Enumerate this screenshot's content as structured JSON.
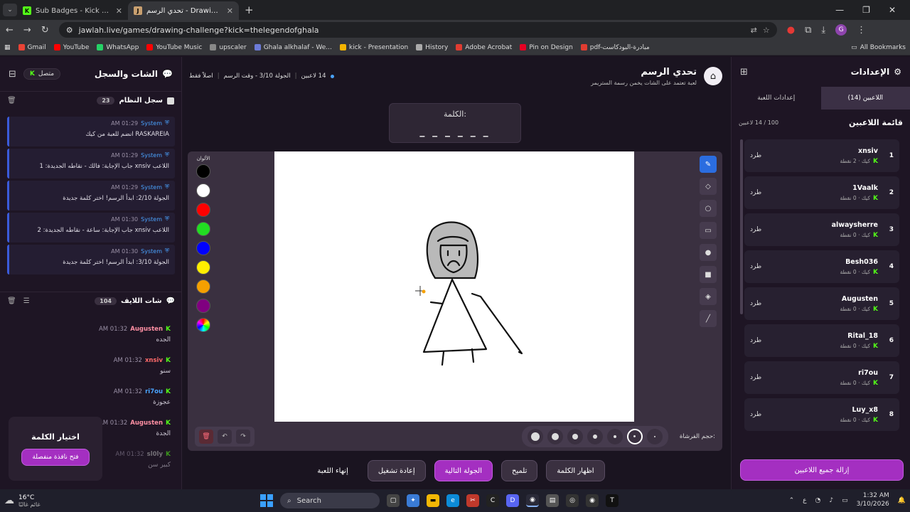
{
  "browser": {
    "tabs": [
      {
        "title": "Sub Badges - Kick Dashboard",
        "fav_color": "#53fc18",
        "fav_glyph": "K"
      },
      {
        "title": "تحدي الرسم - Drawing Challenge",
        "fav_color": "#c9a070",
        "fav_glyph": "J"
      }
    ],
    "url": "jawlah.live/games/drawing-challenge?kick=thelegendofghala",
    "profile_initial": "G",
    "bookmarks": [
      {
        "label": "Gmail",
        "color": "#ea4335"
      },
      {
        "label": "YouTube",
        "color": "#ff0000"
      },
      {
        "label": "WhatsApp",
        "color": "#25d366"
      },
      {
        "label": "YouTube Music",
        "color": "#ff0000"
      },
      {
        "label": "upscaler",
        "color": "#888888"
      },
      {
        "label": "Ghala alkhalaf - We...",
        "color": "#6c7bd8"
      },
      {
        "label": "kick - Presentation",
        "color": "#f4b400"
      },
      {
        "label": "History",
        "color": "#aaaaaa"
      },
      {
        "label": "Adobe Acrobat",
        "color": "#e03c31"
      },
      {
        "label": "Pin on Design",
        "color": "#e60023"
      },
      {
        "label": "pdf-مبادرة-البودكاست",
        "color": "#e03c31"
      }
    ],
    "all_bookmarks": "All Bookmarks"
  },
  "left": {
    "title": "الشات والسجل",
    "status": "متصل",
    "system_title": "سجل النظام",
    "system_count": "23",
    "system_messages": [
      {
        "who": "System",
        "time": "01:29 AM",
        "text": "RASKAREIA انضم للعبة من كيك"
      },
      {
        "who": "System",
        "time": "01:29 AM",
        "text": "اللاعب xnsiv جاب الإجابة: فالك - نقاطه الجديدة: 1"
      },
      {
        "who": "System",
        "time": "01:29 AM",
        "text": "الجولة 2/10: ابدأ الرسم! اختر كلمة جديدة"
      },
      {
        "who": "System",
        "time": "01:30 AM",
        "text": "اللاعب xnsiv جاب الإجابة: ساعة - نقاطه الجديدة: 2"
      },
      {
        "who": "System",
        "time": "01:30 AM",
        "text": "الجولة 3/10: ابدأ الرسم! اختر كلمة جديدة"
      }
    ],
    "chat_title": "شات اللايف",
    "chat_count": "104",
    "chat_messages": [
      {
        "who": "Augusten",
        "color": "#ff8fa3",
        "time": "01:32 AM",
        "text": "الجده"
      },
      {
        "who": "xnsiv",
        "color": "#ff6b6b",
        "time": "01:32 AM",
        "text": "سنو"
      },
      {
        "who": "ri7ou",
        "color": "#4aa3ff",
        "time": "01:32 AM",
        "text": "عجوزة"
      },
      {
        "who": "Augusten",
        "color": "#ff8fa3",
        "time": "01:32 AM",
        "text": "الجدة"
      },
      {
        "who": "sl0ly",
        "color": "#888888",
        "time": "01:32 AM",
        "text": "كبير سن"
      }
    ],
    "word_card_title": "اختيار الكلمة",
    "word_card_button": "فتح نافذة منفصلة"
  },
  "center": {
    "title": "تحدي الرسم",
    "subtitle": "لعبة تعتمد على الشات يخمن رسمة الستريمر",
    "meta_players": "14 لاعبين",
    "meta_round": "الجولة 3/10 - وقت الرسم",
    "meta_admin": "اصلاً فقط",
    "word_label": "الكلمة:",
    "word_blanks": "_ _ _ _ _ _",
    "palette_label": "الألوان",
    "palette": [
      "#000000",
      "#ffffff",
      "#ff0000",
      "#22dd22",
      "#0000ff",
      "#ffee00",
      "#f5a000",
      "#800080"
    ],
    "tools": [
      "pencil-icon",
      "eraser-icon",
      "circle-icon",
      "rect-icon",
      "filled-circle-icon",
      "filled-rect-icon",
      "fill-icon",
      "line-icon"
    ],
    "brush_label": "حجم الفرشاة:",
    "actions": {
      "show_word": "اظهار الكلمة",
      "hint": "تلميح",
      "next_round": "الجولة التالية",
      "restart": "إعادة تشغيل",
      "end_game": "إنهاء اللعبة"
    }
  },
  "right": {
    "title": "الإعدادات",
    "tab_players": "اللاعبين (14)",
    "tab_settings": "إعدادات اللعبة",
    "list_title": "قائمة اللاعبين",
    "list_count": "100 / 14 لاعبين",
    "kick_label": "طرد",
    "players": [
      {
        "rank": "1",
        "name": "xnsiv",
        "points": "كيك · 2 نقطة"
      },
      {
        "rank": "2",
        "name": "1Vaalk",
        "points": "كيك · 0 نقطة"
      },
      {
        "rank": "3",
        "name": "alwaysherre",
        "points": "كيك · 0 نقطة"
      },
      {
        "rank": "4",
        "name": "Besh036",
        "points": "كيك · 0 نقطة"
      },
      {
        "rank": "5",
        "name": "Augusten",
        "points": "كيك · 0 نقطة"
      },
      {
        "rank": "6",
        "name": "Rital_18",
        "points": "كيك · 0 نقطة"
      },
      {
        "rank": "7",
        "name": "ri7ou",
        "points": "كيك · 0 نقطة"
      },
      {
        "rank": "8",
        "name": "Luy_x8",
        "points": "كيك · 0 نقطة"
      }
    ],
    "remove_all": "إزالة جميع اللاعبين"
  },
  "taskbar": {
    "temp": "16°C",
    "weather": "غائم غالبًا",
    "search": "Search",
    "time": "1:32 AM",
    "date": "3/10/2026"
  }
}
